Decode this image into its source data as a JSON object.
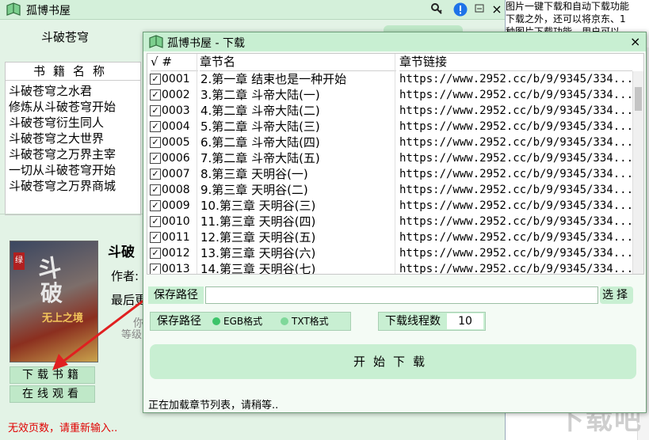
{
  "background": {
    "text_lines": [
      "图片一键下载和自动下载功能",
      "下载之外，还可以将京东、1",
      "种图片下载功能，用户可以"
    ],
    "watermark": "下载吧"
  },
  "main": {
    "title": "孤博书屋",
    "search_value": "斗破苍穹",
    "list_header": "书籍名称",
    "books": [
      "斗破苍穹之水君",
      "修炼从斗破苍穹开始",
      "斗破苍穹衍生同人",
      "斗破苍穹之大世界",
      "斗破苍穹之万界主宰",
      "一切从斗破苍穹开始",
      "斗破苍穹之万界商城"
    ],
    "book_title": "斗破",
    "author_label": "作者:",
    "updated_label": "最后更",
    "grey1": "你",
    "grey2": "等级",
    "cover_title1": "斗",
    "cover_title2": "破",
    "cover_sub": "无上之境",
    "cover_badge": "绿",
    "download_button": "下载书籍",
    "read_button": "在线观看",
    "status": "无效页数，请重新输入.."
  },
  "dialog": {
    "title": "孤博书屋 - 下载",
    "close": "×",
    "col_check": "√ #",
    "col_chapter": "章节名",
    "col_link": "章节链接",
    "rows": [
      {
        "num": "0001",
        "chapter": "2.第一章 结束也是一种开始",
        "link": "https://www.2952.cc/b/9/9345/334..."
      },
      {
        "num": "0002",
        "chapter": "3.第二章 斗帝大陆(一)",
        "link": "https://www.2952.cc/b/9/9345/334..."
      },
      {
        "num": "0003",
        "chapter": "4.第二章 斗帝大陆(二)",
        "link": "https://www.2952.cc/b/9/9345/334..."
      },
      {
        "num": "0004",
        "chapter": "5.第二章 斗帝大陆(三)",
        "link": "https://www.2952.cc/b/9/9345/334..."
      },
      {
        "num": "0005",
        "chapter": "6.第二章 斗帝大陆(四)",
        "link": "https://www.2952.cc/b/9/9345/334..."
      },
      {
        "num": "0006",
        "chapter": "7.第二章 斗帝大陆(五)",
        "link": "https://www.2952.cc/b/9/9345/334..."
      },
      {
        "num": "0007",
        "chapter": "8.第三章 天明谷(一)",
        "link": "https://www.2952.cc/b/9/9345/334..."
      },
      {
        "num": "0008",
        "chapter": "9.第三章 天明谷(二)",
        "link": "https://www.2952.cc/b/9/9345/334..."
      },
      {
        "num": "0009",
        "chapter": "10.第三章 天明谷(三)",
        "link": "https://www.2952.cc/b/9/9345/334..."
      },
      {
        "num": "0010",
        "chapter": "11.第三章 天明谷(四)",
        "link": "https://www.2952.cc/b/9/9345/334..."
      },
      {
        "num": "0011",
        "chapter": "12.第三章 天明谷(五)",
        "link": "https://www.2952.cc/b/9/9345/334..."
      },
      {
        "num": "0012",
        "chapter": "13.第三章 天明谷(六)",
        "link": "https://www.2952.cc/b/9/9345/334..."
      },
      {
        "num": "0013",
        "chapter": "14.第三章 天明谷(七)",
        "link": "https://www.2952.cc/b/9/9345/334..."
      }
    ],
    "save_path_label": "保存路径",
    "save_path_value": "",
    "browse_button": "选择",
    "format_label": "保存路径",
    "format_egb": "EGB格式",
    "format_txt": "TXT格式",
    "thread_label": "下载线程数",
    "thread_value": "10",
    "start_button": "开始下载",
    "status": "正在加载章节列表，请稍等.."
  },
  "colors": {
    "dot_selected": "#3cc46a",
    "dot_unselected": "#7fd89a",
    "status_red": "#e00000"
  }
}
